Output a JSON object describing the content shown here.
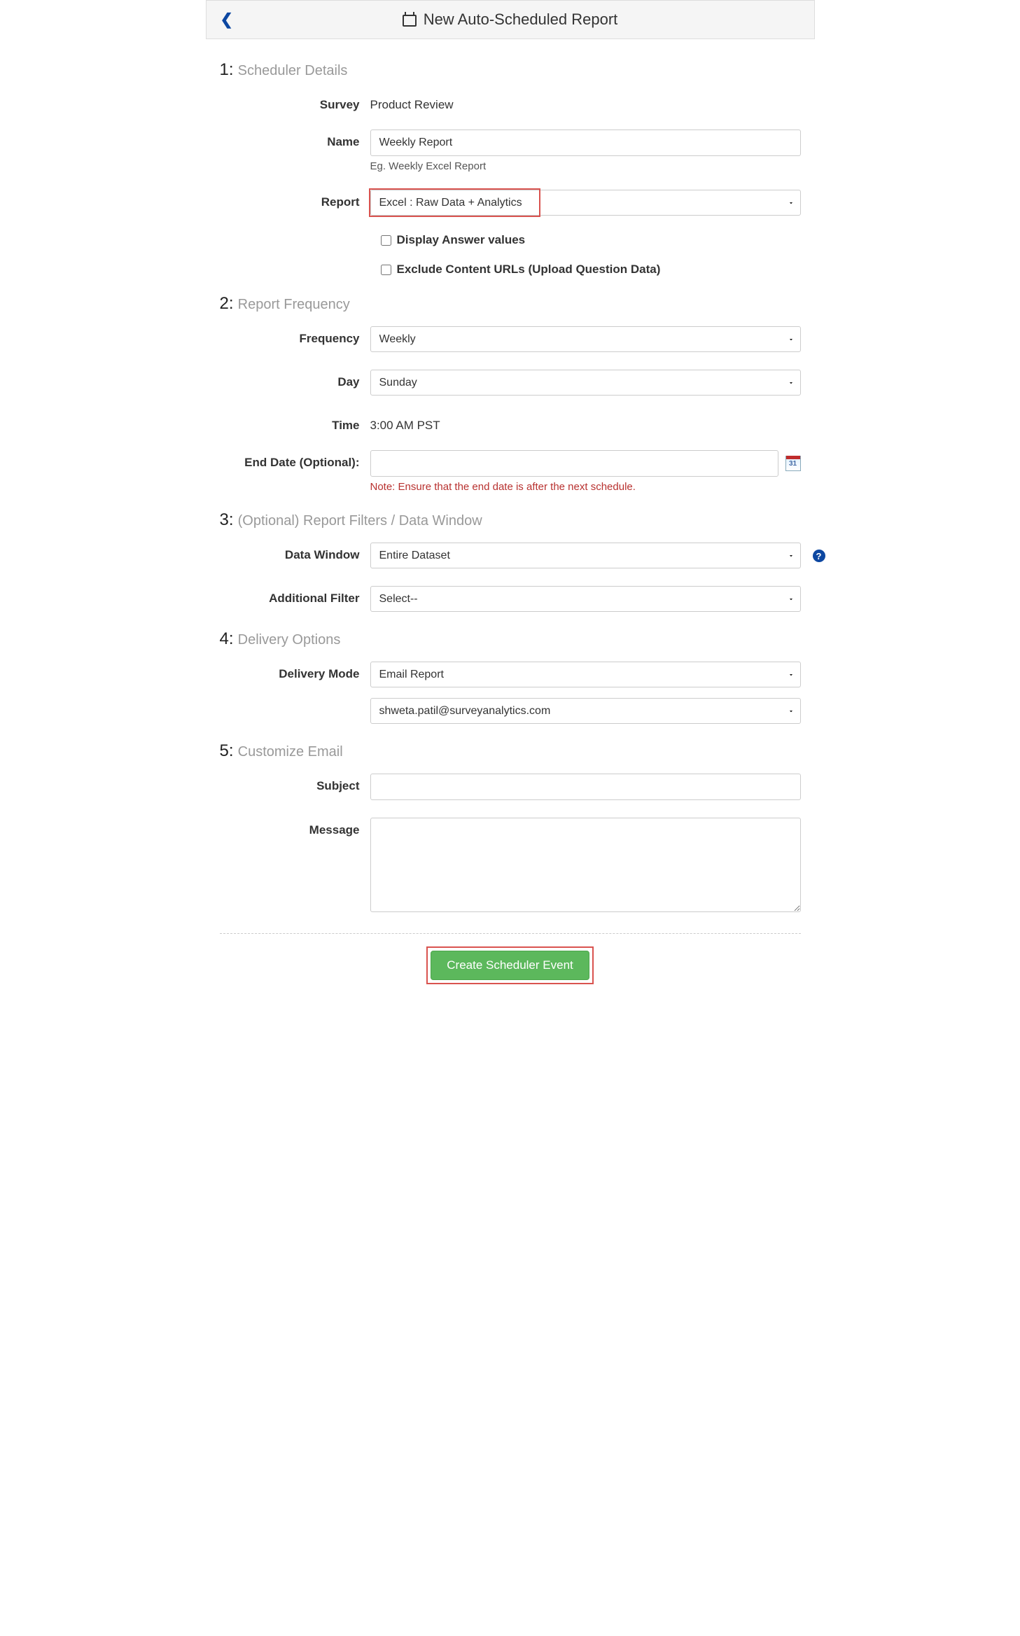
{
  "header": {
    "title": "New Auto-Scheduled Report"
  },
  "sections": {
    "s1": {
      "num": "1:",
      "txt": "Scheduler Details"
    },
    "s2": {
      "num": "2:",
      "txt": "Report Frequency"
    },
    "s3": {
      "num": "3:",
      "txt": "(Optional) Report Filters / Data Window"
    },
    "s4": {
      "num": "4:",
      "txt": "Delivery Options"
    },
    "s5": {
      "num": "5:",
      "txt": "Customize Email"
    }
  },
  "labels": {
    "survey": "Survey",
    "name": "Name",
    "report": "Report",
    "frequency": "Frequency",
    "day": "Day",
    "time": "Time",
    "end_date": "End Date (Optional):",
    "data_window": "Data Window",
    "additional_filter": "Additional Filter",
    "delivery_mode": "Delivery Mode",
    "subject": "Subject",
    "message": "Message"
  },
  "values": {
    "survey": "Product Review",
    "name": "Weekly Report",
    "name_hint": "Eg. Weekly Excel Report",
    "report": "Excel : Raw Data + Analytics",
    "display_answer": "Display Answer values",
    "exclude_urls": "Exclude Content URLs (Upload Question Data)",
    "frequency": "Weekly",
    "day": "Sunday",
    "time": "3:00 AM PST",
    "end_date": "",
    "end_date_note": "Note: Ensure that the end date is after the next schedule.",
    "data_window": "Entire Dataset",
    "additional_filter": "Select--",
    "delivery_mode": "Email Report",
    "email": "shweta.patil@surveyanalytics.com",
    "subject": "",
    "message": "",
    "calendar_day": "31"
  },
  "submit": {
    "label": "Create Scheduler Event"
  }
}
